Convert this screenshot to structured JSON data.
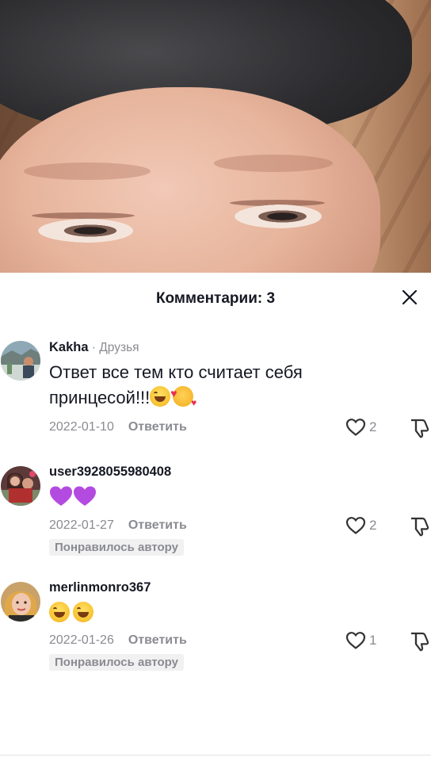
{
  "sheet": {
    "title": "Комментарии: 3"
  },
  "comments": [
    {
      "username": "Kakha",
      "friend_tag": " · Друзья",
      "text": "Ответ все тем кто считает себя принцесой!!!",
      "emojis": [
        "laugh-emoji",
        "smiling-face-with-hearts-emoji"
      ],
      "date": "2022-01-10",
      "reply": "Ответить",
      "likes": "2",
      "author_badge": ""
    },
    {
      "username": "user3928055980408",
      "friend_tag": "",
      "text": "",
      "emojis": [
        "purple-heart-emoji",
        "purple-heart-emoji"
      ],
      "date": "2022-01-27",
      "reply": "Ответить",
      "likes": "2",
      "author_badge": "Понравилось автору"
    },
    {
      "username": "merlinmonro367",
      "friend_tag": "",
      "text": "",
      "emojis": [
        "laugh-emoji",
        "laugh-emoji"
      ],
      "date": "2022-01-26",
      "reply": "Ответить",
      "likes": "1",
      "author_badge": "Понравилось автору"
    }
  ],
  "icons": {
    "close": "close-icon",
    "like": "heart-outline-icon",
    "dislike": "thumbs-down-icon"
  },
  "colors": {
    "text_primary": "#161823",
    "text_secondary": "#8a8b91",
    "badge_bg": "#f1f1f2",
    "purple_heart": "#b44be1"
  }
}
